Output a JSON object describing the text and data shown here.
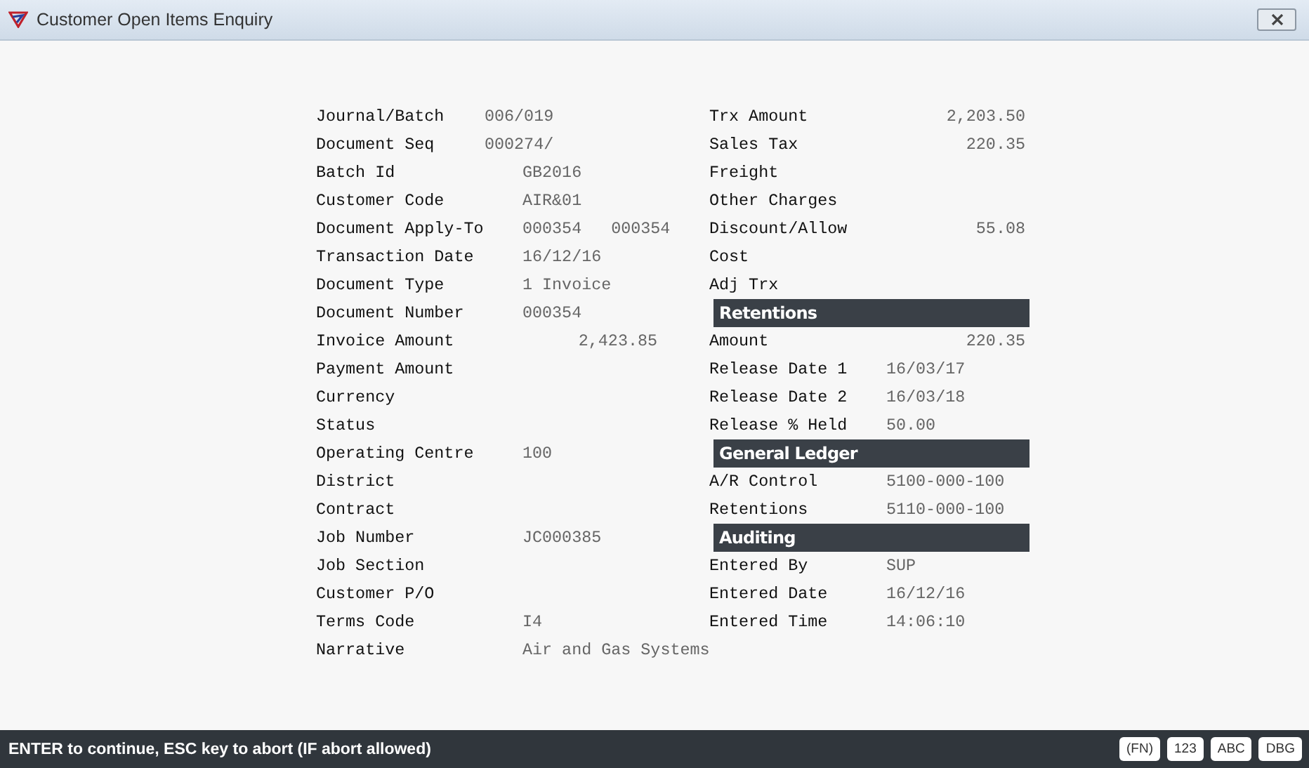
{
  "window": {
    "title": "Customer Open Items Enquiry"
  },
  "left_fields": [
    {
      "kind": "near",
      "label": "Journal/Batch",
      "value": "006/019"
    },
    {
      "kind": "near",
      "label": "Document Seq",
      "value": "000274/"
    },
    {
      "kind": "text",
      "label": "Batch Id",
      "value": "GB2016"
    },
    {
      "kind": "text",
      "label": "Customer Code",
      "value": "AIR&01"
    },
    {
      "kind": "pair",
      "label": "Document Apply-To",
      "value": "000354",
      "value_2": "000354"
    },
    {
      "kind": "text",
      "label": "Transaction Date",
      "value": "16/12/16"
    },
    {
      "kind": "text",
      "label": "Document Type",
      "value": "1 Invoice"
    },
    {
      "kind": "text",
      "label": "Document Number",
      "value": "000354"
    },
    {
      "kind": "amount",
      "label": "Invoice Amount",
      "value": "2,423.85"
    },
    {
      "kind": "text",
      "label": "Payment Amount"
    },
    {
      "kind": "text",
      "label": "Currency"
    },
    {
      "kind": "text",
      "label": "Status"
    },
    {
      "kind": "text",
      "label": "Operating Centre",
      "value": "100"
    },
    {
      "kind": "text",
      "label": "District"
    },
    {
      "kind": "text",
      "label": "Contract"
    },
    {
      "kind": "text",
      "label": "Job Number",
      "value": "JC000385"
    },
    {
      "kind": "text",
      "label": "Job Section"
    },
    {
      "kind": "text",
      "label": "Customer P/O"
    },
    {
      "kind": "text",
      "label": "Terms Code",
      "value": "I4"
    },
    {
      "kind": "text",
      "label": "Narrative",
      "value": "Air and Gas Systems"
    }
  ],
  "right_fields": [
    {
      "kind": "amount",
      "label": "Trx Amount",
      "value": "2,203.50"
    },
    {
      "kind": "amount",
      "label": "Sales Tax",
      "value": "220.35"
    },
    {
      "kind": "amount",
      "label": "Freight"
    },
    {
      "kind": "amount",
      "label": "Other Charges"
    },
    {
      "kind": "amount",
      "label": "Discount/Allow",
      "value": "55.08"
    },
    {
      "kind": "amount",
      "label": "Cost"
    },
    {
      "kind": "amount",
      "label": "Adj Trx"
    },
    {
      "kind": "header",
      "label": "Retentions"
    },
    {
      "kind": "amount",
      "label": "Amount",
      "value": "220.35"
    },
    {
      "kind": "text",
      "label": "Release Date 1",
      "value": "16/03/17"
    },
    {
      "kind": "text",
      "label": "Release Date 2",
      "value": "16/03/18"
    },
    {
      "kind": "text",
      "label": "Release % Held",
      "value": "50.00"
    },
    {
      "kind": "header",
      "label": "General Ledger"
    },
    {
      "kind": "text",
      "label": "A/R Control",
      "value": "5100-000-100"
    },
    {
      "kind": "text",
      "label": "Retentions",
      "value": "5110-000-100"
    },
    {
      "kind": "header",
      "label": "Auditing"
    },
    {
      "kind": "text",
      "label": "Entered By",
      "value": "SUP"
    },
    {
      "kind": "text",
      "label": "Entered Date",
      "value": "16/12/16"
    },
    {
      "kind": "text",
      "label": "Entered Time",
      "value": "14:06:10"
    }
  ],
  "status_bar": {
    "message": "ENTER to continue, ESC key to abort (IF abort allowed)",
    "badges": [
      "(FN)",
      "123",
      "ABC",
      "DBG"
    ]
  }
}
